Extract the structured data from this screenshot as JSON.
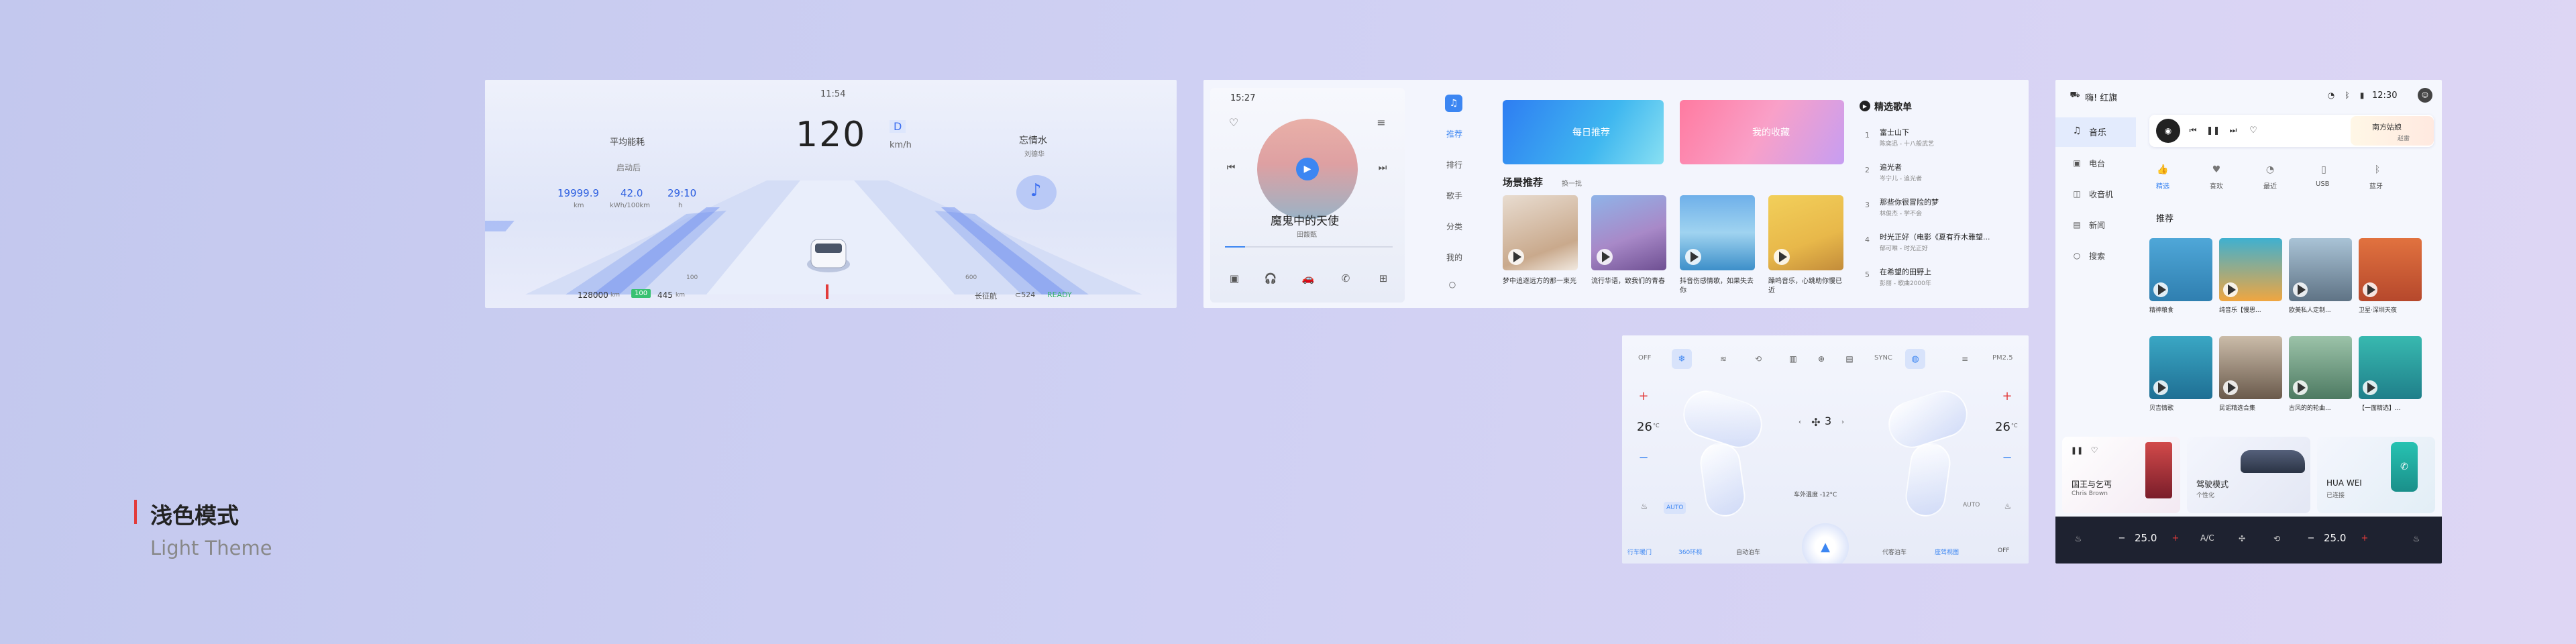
{
  "theme": {
    "title": "浅色模式",
    "subtitle": "Light Theme",
    "accent": "#e23b3b"
  },
  "cluster": {
    "time": "11:54",
    "speed": "120",
    "gear": "D",
    "unit": "km/h",
    "left_title": "平均能耗",
    "left_sub": "启动后",
    "stats": [
      {
        "v": "19999.9",
        "u": "km"
      },
      {
        "v": "42.0",
        "u": "kWh/100km"
      },
      {
        "v": "29:10",
        "u": "h"
      }
    ],
    "song": "忘情水",
    "artist": "刘德华",
    "odo": "128000",
    "odo_unit": "km",
    "range_badge": "100",
    "range": "445",
    "range_unit": "km",
    "mark_left": "100",
    "mark_right": "600",
    "bottom_labels": [
      "长征航",
      "⊂524",
      "READY"
    ]
  },
  "media": {
    "time": "15:27",
    "song": "魔鬼中的天使",
    "artist": "田馥甄",
    "nav": [
      "推荐",
      "排行",
      "歌手",
      "分类",
      "我的"
    ],
    "banners": [
      "每日推荐",
      "我的收藏"
    ],
    "scene_title": "场景推荐",
    "scene_more": "换一批",
    "scenes": [
      "梦中追逐远方的那一束光",
      "流行华语，致我们的青春",
      "抖音伤感情歌，如果失去你",
      "躁鸣音乐，心跳助你慢已近"
    ],
    "playlist_title": "精选歌单",
    "playlist": [
      {
        "n": "1",
        "t": "富士山下",
        "s": "陈奕迅 - 十八般武艺"
      },
      {
        "n": "2",
        "t": "追光者",
        "s": "岑宁儿 - 追光者"
      },
      {
        "n": "3",
        "t": "那些你很冒险的梦",
        "s": "林俊杰 - 学不会"
      },
      {
        "n": "4",
        "t": "时光正好（电影《夏有乔木雅望...",
        "s": "郁可唯 - 时光正好"
      },
      {
        "n": "5",
        "t": "在希望的田野上",
        "s": "彭丽 - 歌曲2000年"
      }
    ]
  },
  "climate": {
    "top": [
      "OFF",
      "SYNC",
      "PM2.5"
    ],
    "left_temp": "26",
    "right_temp": "26",
    "unit": "°C",
    "fan": "3",
    "auto": "AUTO",
    "outside": "车外温度 -12°C",
    "bottom": [
      "行车暖门",
      "360环视",
      "自动泊车",
      "",
      "代客泊车",
      "座驾视图",
      "OFF"
    ]
  },
  "music": {
    "header": "嗨! 红旗",
    "time": "12:30",
    "nav": [
      "音乐",
      "电台",
      "收音机",
      "新闻",
      "搜索"
    ],
    "player_station": "南方姑娘",
    "player_sub": "赵雷",
    "tabs": [
      "精选",
      "喜欢",
      "最近",
      "USB",
      "蓝牙"
    ],
    "section": "推荐",
    "tiles": [
      "精神粮食",
      "纯音乐【慢思...",
      "欧美私人定制...",
      "卫星·深圳天夜",
      "贝吉情歌",
      "民谣精选合集",
      "古风的的轮曲...",
      "【一面精选】..."
    ],
    "cards": [
      {
        "t": "国王与乞丐",
        "s": "Chris Brown"
      },
      {
        "t": "驾驶模式",
        "s": "个性化"
      },
      {
        "t": "HUA WEI",
        "s": "已连接"
      }
    ],
    "bar": [
      "25.0",
      "A/C",
      "25.0"
    ]
  }
}
